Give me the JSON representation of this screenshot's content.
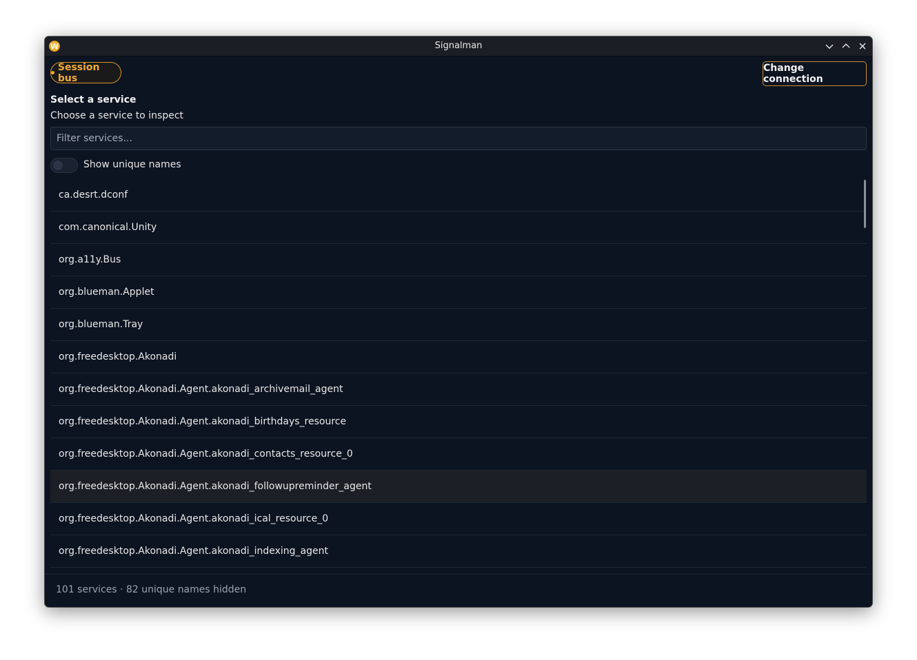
{
  "window": {
    "title": "Signalman",
    "app_icon": "W"
  },
  "header": {
    "bus_label": "Session bus",
    "change_connection_label": "Change connection"
  },
  "service_picker": {
    "heading": "Select a service",
    "subheading": "Choose a service to inspect",
    "filter_placeholder": "Filter services...",
    "filter_value": "",
    "toggle_label": "Show unique names",
    "toggle_on": false
  },
  "services": [
    "ca.desrt.dconf",
    "com.canonical.Unity",
    "org.a11y.Bus",
    "org.blueman.Applet",
    "org.blueman.Tray",
    "org.freedesktop.Akonadi",
    "org.freedesktop.Akonadi.Agent.akonadi_archivemail_agent",
    "org.freedesktop.Akonadi.Agent.akonadi_birthdays_resource",
    "org.freedesktop.Akonadi.Agent.akonadi_contacts_resource_0",
    "org.freedesktop.Akonadi.Agent.akonadi_followupreminder_agent",
    "org.freedesktop.Akonadi.Agent.akonadi_ical_resource_0",
    "org.freedesktop.Akonadi.Agent.akonadi_indexing_agent"
  ],
  "hovered_service": "org.freedesktop.Akonadi.Agent.akonadi_followupreminder_agent",
  "footer": {
    "status": "101 services · 82 unique names hidden"
  },
  "colors": {
    "accent": "#f0a93a",
    "background": "#0d1421"
  }
}
